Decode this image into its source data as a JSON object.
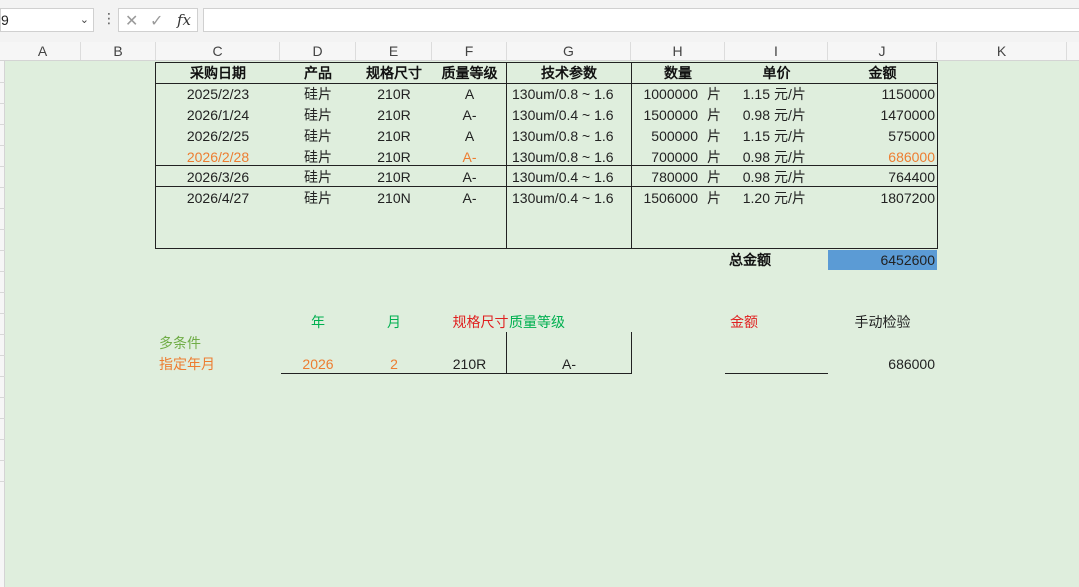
{
  "formula_bar": {
    "name_box": "9",
    "menu_glyph": "⋮",
    "cancel_glyph": "✕",
    "confirm_glyph": "✓",
    "fx_label": "fx",
    "formula": ""
  },
  "columns": [
    "A",
    "B",
    "C",
    "D",
    "E",
    "F",
    "G",
    "H",
    "I",
    "J",
    "K"
  ],
  "table": {
    "headers": {
      "date": "采购日期",
      "product": "产品",
      "spec": "规格尺寸",
      "grade": "质量等级",
      "tech": "技术参数",
      "qty": "数量",
      "price": "单价",
      "amount": "金额"
    },
    "rows": [
      {
        "date": "2025/2/23",
        "product": "硅片",
        "spec": "210R",
        "grade": "A",
        "tech": "130um/0.8 ~ 1.6",
        "qty": "1000000",
        "unit": "片",
        "price": "1.15",
        "price_unit": "元/片",
        "amount": "1150000"
      },
      {
        "date": "2026/1/24",
        "product": "硅片",
        "spec": "210R",
        "grade": "A-",
        "tech": "130um/0.4 ~ 1.6",
        "qty": "1500000",
        "unit": "片",
        "price": "0.98",
        "price_unit": "元/片",
        "amount": "1470000"
      },
      {
        "date": "2026/2/25",
        "product": "硅片",
        "spec": "210R",
        "grade": "A",
        "tech": "130um/0.8 ~ 1.6",
        "qty": "500000",
        "unit": "片",
        "price": "1.15",
        "price_unit": "元/片",
        "amount": "575000"
      },
      {
        "date": "2026/2/28",
        "product": "硅片",
        "spec": "210R",
        "grade": "A-",
        "tech": "130um/0.8 ~ 1.6",
        "qty": "700000",
        "unit": "片",
        "price": "0.98",
        "price_unit": "元/片",
        "amount": "686000"
      },
      {
        "date": "2026/3/26",
        "product": "硅片",
        "spec": "210R",
        "grade": "A-",
        "tech": "130um/0.4 ~ 1.6",
        "qty": "780000",
        "unit": "片",
        "price": "0.98",
        "price_unit": "元/片",
        "amount": "764400"
      },
      {
        "date": "2026/4/27",
        "product": "硅片",
        "spec": "210N",
        "grade": "A-",
        "tech": "130um/0.4 ~ 1.6",
        "qty": "1506000",
        "unit": "片",
        "price": "1.20",
        "price_unit": "元/片",
        "amount": "1807200"
      }
    ],
    "total_label": "总金额",
    "total_value": "6452600"
  },
  "query": {
    "headers": {
      "year": "年",
      "month": "月",
      "spec": "规格尺寸",
      "grade": "质量等级",
      "amount": "金额",
      "manual": "手动检验"
    },
    "title_line1": "多条件",
    "title_line2": "指定年月",
    "year": "2026",
    "month": "2",
    "spec": "210R",
    "grade": "A-",
    "amount": "",
    "manual_value": "686000"
  },
  "colors": {
    "orange": "#ed7d31",
    "green": "#00b050",
    "red": "#e02020",
    "olive": "#70ad47",
    "select_blue": "#5b9bd5"
  }
}
